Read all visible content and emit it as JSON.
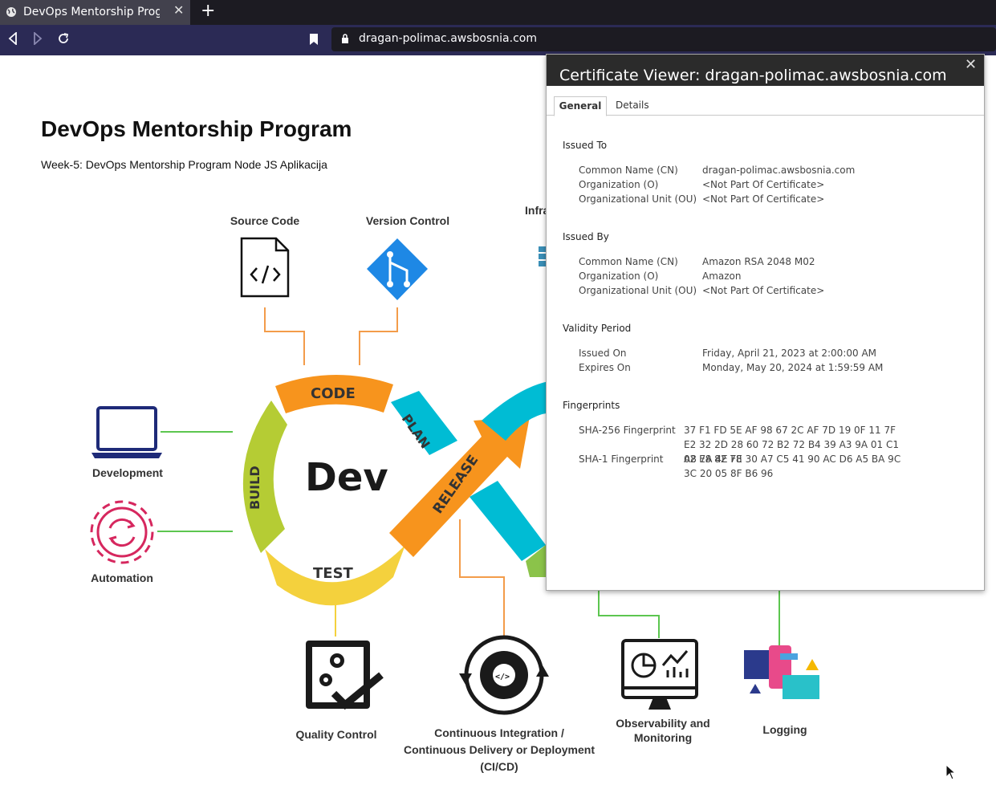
{
  "browser": {
    "tab_title": "DevOps Mentorship Program",
    "tab_close": "✕",
    "new_tab": "+",
    "url": "dragan-polimac.awsbosnia.com"
  },
  "page": {
    "title": "DevOps Mentorship Program",
    "subtitle": "Week-5: DevOps Mentorship Program Node JS Aplikacija",
    "diagram": {
      "center_text": "Dev",
      "arrow_labels": {
        "code": "CODE",
        "plan": "PLAN",
        "build": "BUILD",
        "test": "TEST",
        "release": "RELEASE"
      },
      "labels": {
        "source_code": "Source Code",
        "version_control": "Version Control",
        "infra_partial": "Infra",
        "development": "Development",
        "automation": "Automation",
        "quality_control": "Quality Control",
        "cicd_line1": "Continuous Integration /",
        "cicd_line2": "Continuous Delivery or Deployment",
        "cicd_line3": "(CI/CD)",
        "observability_line1": "Observability and",
        "observability_line2": "Monitoring",
        "logging": "Logging"
      },
      "colors": {
        "orange": "#f7941d",
        "yellow_green": "#b5cc34",
        "yellow": "#f4d13d",
        "cyan": "#00bcd4",
        "green_line": "#5cc64f",
        "orange_line": "#f39c4a",
        "navy": "#1e2a78",
        "crimson": "#d6275e",
        "git_blue": "#1e88e5"
      }
    }
  },
  "cert_viewer": {
    "title": "Certificate Viewer: dragan-polimac.awsbosnia.com",
    "close": "✕",
    "tabs": [
      "General",
      "Details"
    ],
    "issued_to": {
      "heading": "Issued To",
      "rows": [
        {
          "key": "Common Name (CN)",
          "value": "dragan-polimac.awsbosnia.com"
        },
        {
          "key": "Organization (O)",
          "value": "<Not Part Of Certificate>"
        },
        {
          "key": "Organizational Unit (OU)",
          "value": "<Not Part Of Certificate>"
        }
      ]
    },
    "issued_by": {
      "heading": "Issued By",
      "rows": [
        {
          "key": "Common Name (CN)",
          "value": "Amazon RSA 2048 M02"
        },
        {
          "key": "Organization (O)",
          "value": "Amazon"
        },
        {
          "key": "Organizational Unit (OU)",
          "value": "<Not Part Of Certificate>"
        }
      ]
    },
    "validity": {
      "heading": "Validity Period",
      "rows": [
        {
          "key": "Issued On",
          "value": "Friday, April 21, 2023 at 2:00:00 AM"
        },
        {
          "key": "Expires On",
          "value": "Monday, May 20, 2024 at 1:59:59 AM"
        }
      ]
    },
    "fingerprints": {
      "heading": "Fingerprints",
      "rows": [
        {
          "key": "SHA-256 Fingerprint",
          "value": "37 F1 FD 5E AF 98 67 2C AF 7D 19 0F 11 7F E2 32 2D 28 60 72 B2 72 B4 39 A3 9A 01 C1 02 E8 82 78"
        },
        {
          "key": "SHA-1 Fingerprint",
          "value": "A8 7A 4E FE 30 A7 C5 41 90 AC D6 A5 BA 9C 3C 20 05 8F B6 96"
        }
      ]
    }
  }
}
